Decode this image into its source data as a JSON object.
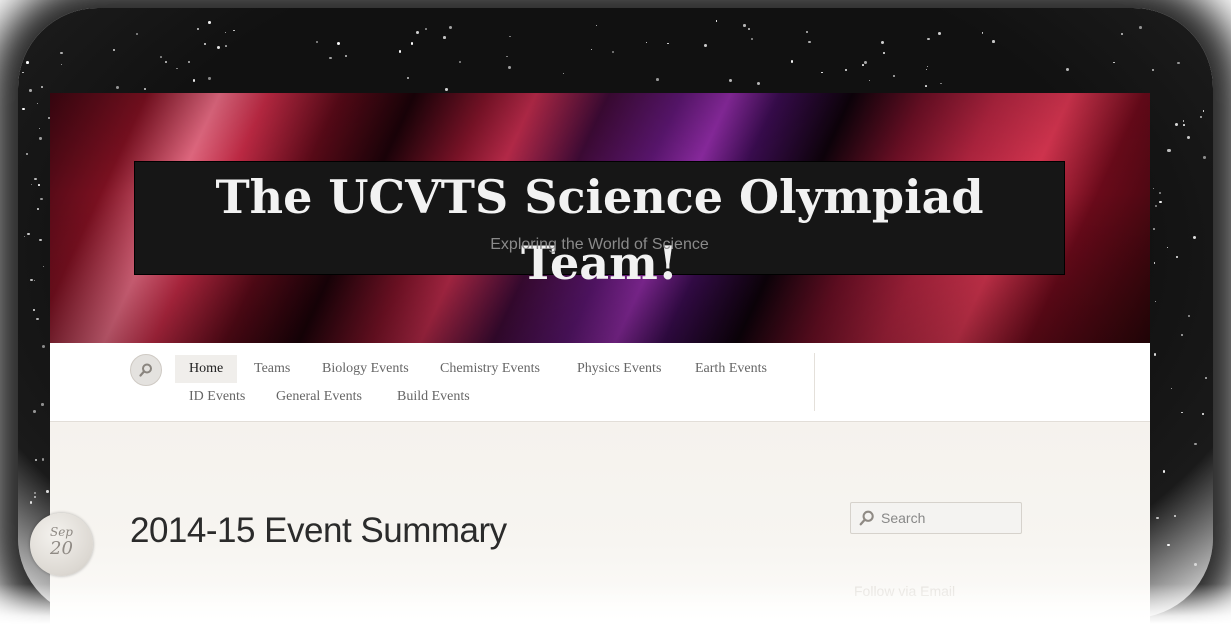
{
  "header": {
    "site_title": "The UCVTS Science Olympiad Team!",
    "site_description": "Exploring the World of Science"
  },
  "nav": {
    "search_icon": "search-icon",
    "items": [
      {
        "label": "Home",
        "active": true
      },
      {
        "label": "Teams"
      },
      {
        "label": "Biology Events"
      },
      {
        "label": "Chemistry Events"
      },
      {
        "label": "Physics Events"
      },
      {
        "label": "Earth Events"
      },
      {
        "label": "ID Events"
      },
      {
        "label": "General Events"
      },
      {
        "label": "Build Events"
      }
    ]
  },
  "post": {
    "date_month": "Sep",
    "date_day": "20",
    "title": "2014-15 Event Summary"
  },
  "sidebar": {
    "search_placeholder": "Search",
    "follow_label": "Follow via Email"
  },
  "colors": {
    "nav_active_bg": "#f0eeeb",
    "content_bg": "#f6f3ee",
    "title_box_bg": "#161616"
  }
}
